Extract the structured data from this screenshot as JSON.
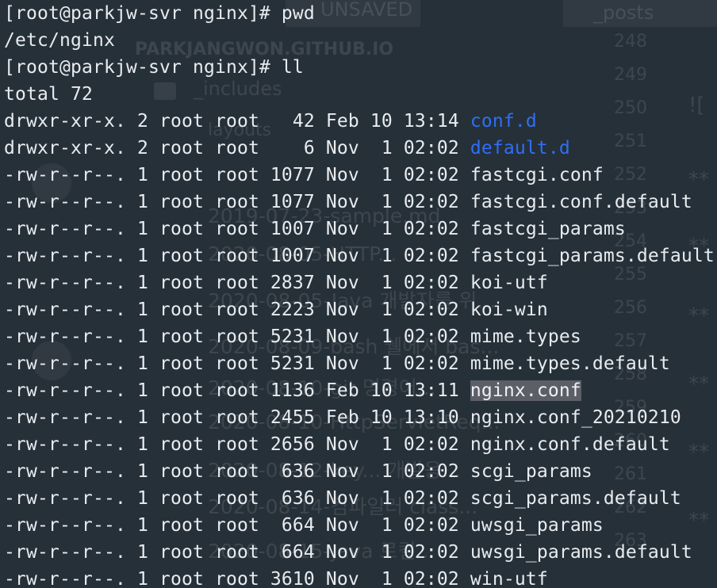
{
  "background_ghost": {
    "tab_unsaved": "UNSAVED",
    "tab_posts": "_posts",
    "repo_title": "PARKJANGWON.GITHUB.IO",
    "folder_includes": "_includes",
    "folder_layouts": "layouts",
    "line_numbers": [
      "248",
      "249",
      "250",
      "251",
      "252",
      "253",
      "254",
      "255",
      "256",
      "257",
      "258",
      "259",
      "260",
      "261",
      "262",
      "263"
    ],
    "files": [
      "2019-07-23-sample.md",
      "2020-08-05-HTTP...",
      "2020-08-05-Java 개발자를 위...",
      "2020-08-09-bash 쉘에서 bas...",
      "2020-08-10-git 명령어...",
      "2020-08-10-HttpServletReq...",
      "2020-08-12-key... 개발응...",
      "2020-08-14-컴파일러 class...",
      "2020-08-15-Java 로컬..."
    ],
    "stars": [
      "![",
      "**",
      "**",
      "**",
      "**",
      "**",
      "**"
    ]
  },
  "terminal": {
    "colors": {
      "background": "#263039",
      "text": "#e8ecef",
      "directory": "#2f6ff5",
      "highlight": "#5c5f67"
    },
    "lines": [
      {
        "kind": "text",
        "text": "[root@parkjw-svr nginx]# pwd"
      },
      {
        "kind": "text",
        "text": "/etc/nginx"
      },
      {
        "kind": "text",
        "text": "[root@parkjw-svr nginx]# ll"
      },
      {
        "kind": "text",
        "text": "total 72"
      },
      {
        "kind": "entry",
        "prefix": "drwxr-xr-x. 2 root root   42 Feb 10 13:14 ",
        "name": "conf.d",
        "style": "dir"
      },
      {
        "kind": "entry",
        "prefix": "drwxr-xr-x. 2 root root    6 Nov  1 02:02 ",
        "name": "default.d",
        "style": "dir"
      },
      {
        "kind": "entry",
        "prefix": "-rw-r--r--. 1 root root 1077 Nov  1 02:02 ",
        "name": "fastcgi.conf",
        "style": "file"
      },
      {
        "kind": "entry",
        "prefix": "-rw-r--r--. 1 root root 1077 Nov  1 02:02 ",
        "name": "fastcgi.conf.default",
        "style": "file"
      },
      {
        "kind": "entry",
        "prefix": "-rw-r--r--. 1 root root 1007 Nov  1 02:02 ",
        "name": "fastcgi_params",
        "style": "file"
      },
      {
        "kind": "entry",
        "prefix": "-rw-r--r--. 1 root root 1007 Nov  1 02:02 ",
        "name": "fastcgi_params.default",
        "style": "file"
      },
      {
        "kind": "entry",
        "prefix": "-rw-r--r--. 1 root root 2837 Nov  1 02:02 ",
        "name": "koi-utf",
        "style": "file"
      },
      {
        "kind": "entry",
        "prefix": "-rw-r--r--. 1 root root 2223 Nov  1 02:02 ",
        "name": "koi-win",
        "style": "file"
      },
      {
        "kind": "entry",
        "prefix": "-rw-r--r--. 1 root root 5231 Nov  1 02:02 ",
        "name": "mime.types",
        "style": "file"
      },
      {
        "kind": "entry",
        "prefix": "-rw-r--r--. 1 root root 5231 Nov  1 02:02 ",
        "name": "mime.types.default",
        "style": "file"
      },
      {
        "kind": "entry",
        "prefix": "-rw-r--r--. 1 root root 1136 Feb 10 13:11 ",
        "name": "nginx.conf",
        "style": "highlight"
      },
      {
        "kind": "entry",
        "prefix": "-rw-r--r--. 1 root root 2455 Feb 10 13:10 ",
        "name": "nginx.conf_20210210",
        "style": "file"
      },
      {
        "kind": "entry",
        "prefix": "-rw-r--r--. 1 root root 2656 Nov  1 02:02 ",
        "name": "nginx.conf.default",
        "style": "file"
      },
      {
        "kind": "entry",
        "prefix": "-rw-r--r--. 1 root root  636 Nov  1 02:02 ",
        "name": "scgi_params",
        "style": "file"
      },
      {
        "kind": "entry",
        "prefix": "-rw-r--r--. 1 root root  636 Nov  1 02:02 ",
        "name": "scgi_params.default",
        "style": "file"
      },
      {
        "kind": "entry",
        "prefix": "-rw-r--r--. 1 root root  664 Nov  1 02:02 ",
        "name": "uwsgi_params",
        "style": "file"
      },
      {
        "kind": "entry",
        "prefix": "-rw-r--r--. 1 root root  664 Nov  1 02:02 ",
        "name": "uwsgi_params.default",
        "style": "file"
      },
      {
        "kind": "entry",
        "prefix": "-rw-r--r--. 1 root root 3610 Nov  1 02:02 ",
        "name": "win-utf",
        "style": "file"
      }
    ]
  }
}
